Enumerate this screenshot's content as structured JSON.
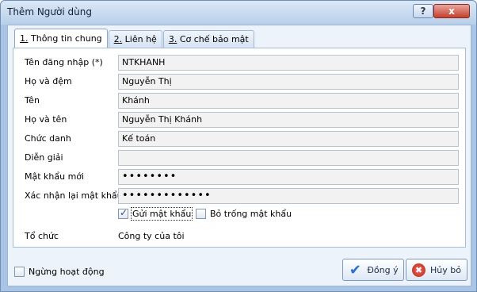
{
  "window": {
    "title": "Thêm Người dùng",
    "help_label": "?",
    "close_label": "x"
  },
  "tabs": [
    {
      "key": "1.",
      "label": "Thông tin chung"
    },
    {
      "key": "2.",
      "label": "Liên hệ"
    },
    {
      "key": "3.",
      "label": "Cơ chế bảo mật"
    }
  ],
  "form": {
    "username": {
      "label": "Tên đăng nhập (*)",
      "value": "NTKHANH"
    },
    "middle_name": {
      "label": "Họ và đệm",
      "value": "Nguyễn Thị"
    },
    "first_name": {
      "label": "Tên",
      "value": "Khánh"
    },
    "full_name": {
      "label": "Họ và tên",
      "value": "Nguyễn Thị Khánh"
    },
    "position": {
      "label": "Chức danh",
      "value": "Kế toán"
    },
    "description": {
      "label": "Diễn giải",
      "value": ""
    },
    "new_password": {
      "label": "Mật khẩu mới",
      "value": "••••••••"
    },
    "confirm_password": {
      "label": "Xác nhận lại mật khẩu",
      "value": "•••••••••••••"
    },
    "send_password": {
      "label": "Gửi mật khẩu",
      "checked": true
    },
    "blank_password": {
      "label": "Bỏ trống mật khẩu",
      "checked": false
    },
    "organization": {
      "label": "Tổ chức",
      "value": "Công ty của tôi"
    }
  },
  "footer": {
    "inactive": {
      "label": "Ngừng hoạt động",
      "checked": false
    },
    "ok_label": "Đồng ý",
    "cancel_label": "Hủy bỏ"
  },
  "icons": {
    "ok": "checkmark-icon",
    "cancel": "cancel-icon"
  }
}
